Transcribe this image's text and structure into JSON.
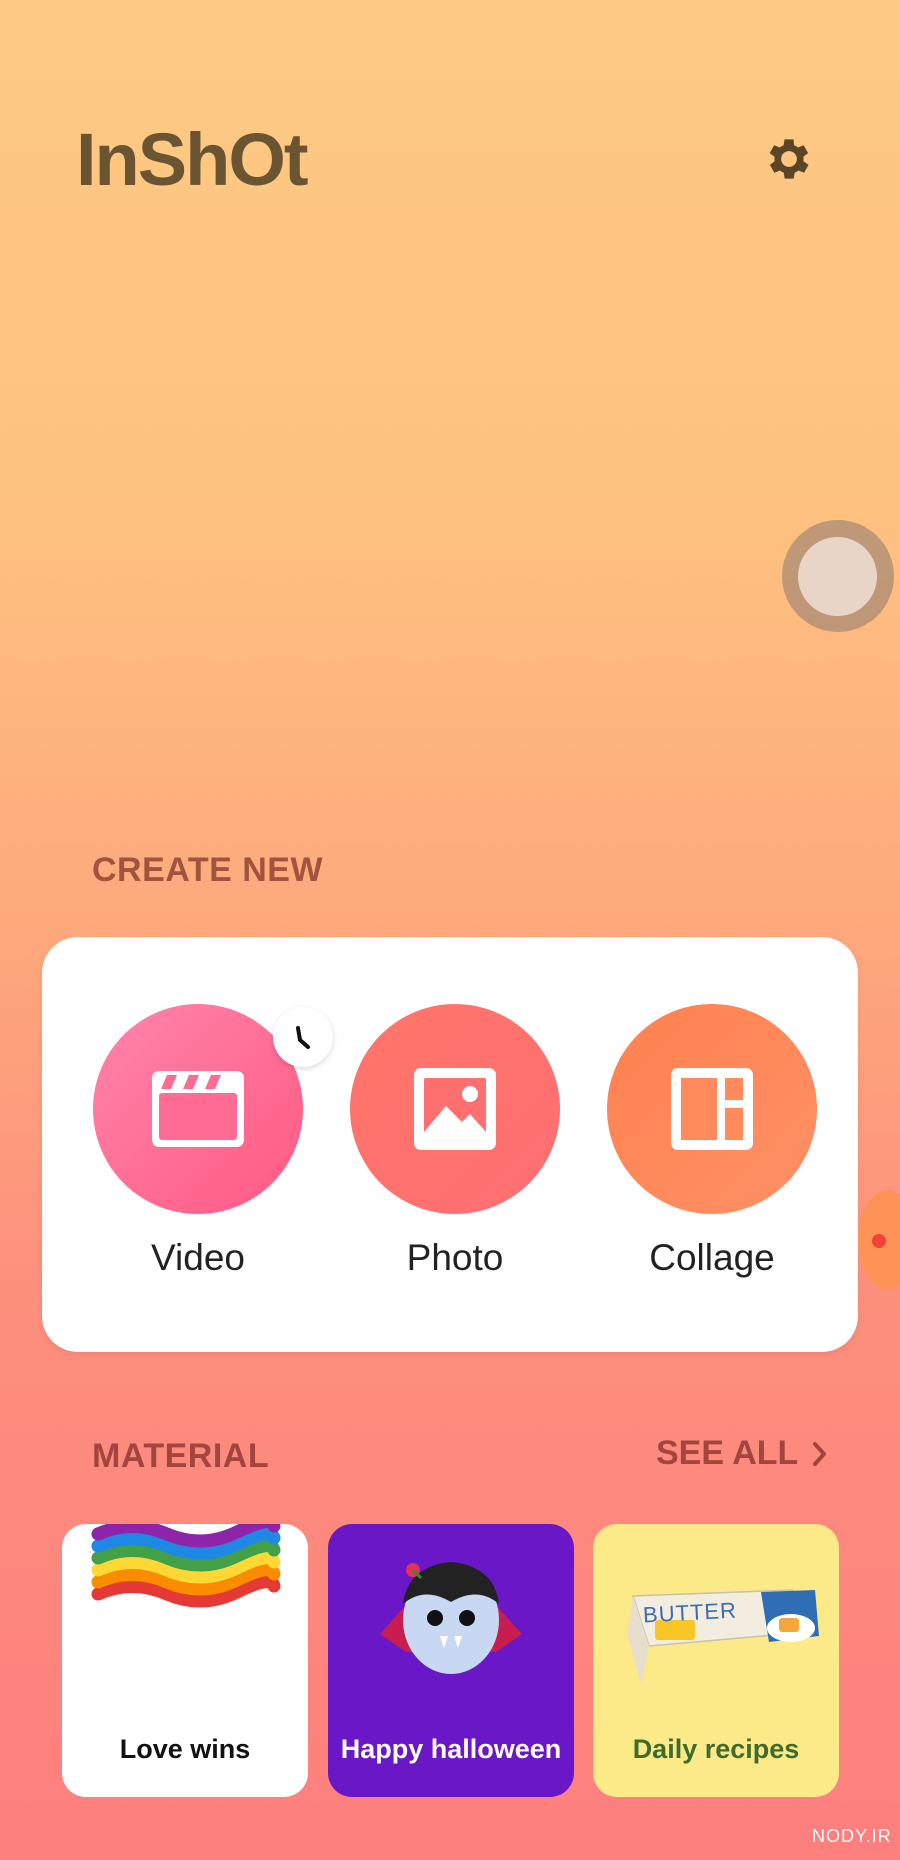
{
  "header": {
    "logo_text": "InShOt"
  },
  "create_new": {
    "title": "CREATE NEW",
    "items": [
      {
        "label": "Video",
        "icon": "clapperboard-icon"
      },
      {
        "label": "Photo",
        "icon": "image-icon"
      },
      {
        "label": "Collage",
        "icon": "collage-layout-icon"
      }
    ]
  },
  "material": {
    "title": "MATERIAL",
    "see_all_label": "SEE ALL",
    "items": [
      {
        "label": "Love wins",
        "label_color": "#111111",
        "bg": "#ffffff"
      },
      {
        "label": "Happy halloween",
        "label_color": "#ffffff",
        "bg": "#6a17c7"
      },
      {
        "label": "Daily recipes",
        "label_color": "#3f6b2c",
        "bg": "#fcea89"
      }
    ],
    "recipe_box_text": "BUTTER"
  },
  "watermark": "NODY.IR",
  "colors": {
    "logo": "#6b5432",
    "section_title": "#a2453e",
    "video": "#ff6b92",
    "photo": "#fe7070",
    "collage": "#ff8a5c"
  }
}
